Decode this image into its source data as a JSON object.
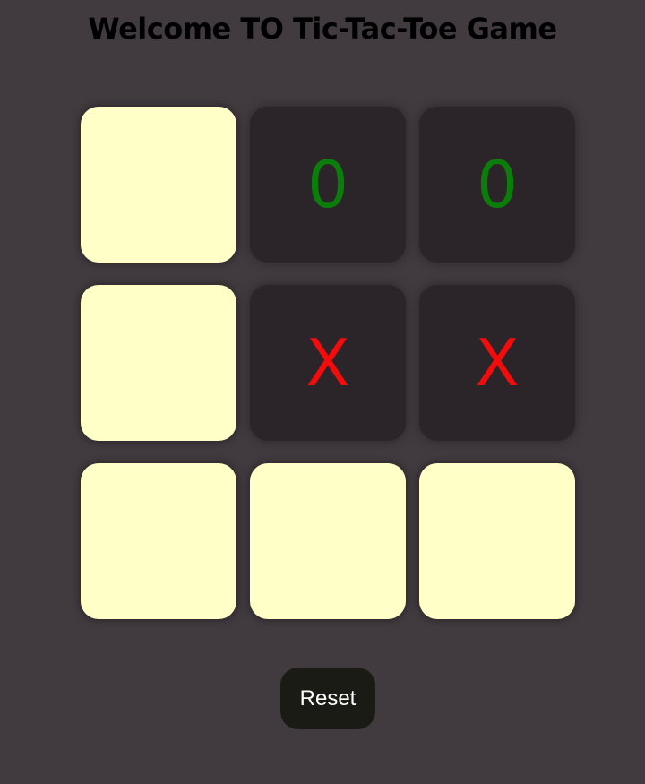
{
  "title": "Welcome TO Tic-Tac-Toe Game",
  "board": [
    {
      "mark": "",
      "state": "empty"
    },
    {
      "mark": "0",
      "state": "o"
    },
    {
      "mark": "0",
      "state": "o"
    },
    {
      "mark": "",
      "state": "empty"
    },
    {
      "mark": "X",
      "state": "x"
    },
    {
      "mark": "X",
      "state": "x"
    },
    {
      "mark": "",
      "state": "empty"
    },
    {
      "mark": "",
      "state": "empty"
    },
    {
      "mark": "",
      "state": "empty"
    }
  ],
  "reset_label": "Reset",
  "colors": {
    "background": "#413a3f",
    "empty_cell": "#ffffc8",
    "filled_cell": "#2b252a",
    "o_mark": "#0b7d0b",
    "x_mark": "#f20c0c",
    "reset_button": "#1b1b16"
  }
}
